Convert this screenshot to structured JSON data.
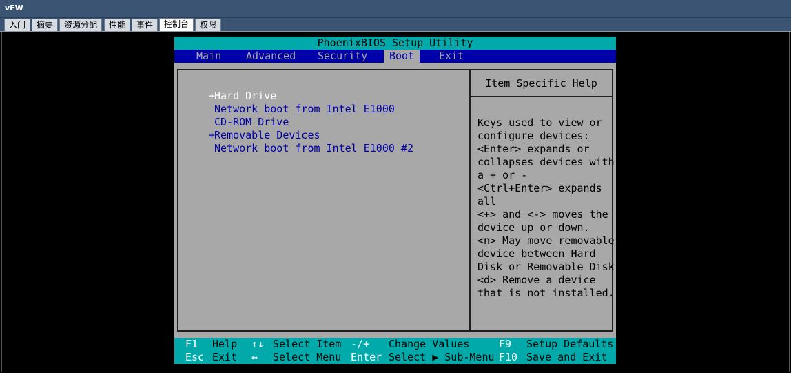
{
  "window": {
    "title": "vFW"
  },
  "tabs": [
    {
      "label": "入门"
    },
    {
      "label": "摘要"
    },
    {
      "label": "资源分配"
    },
    {
      "label": "性能"
    },
    {
      "label": "事件"
    },
    {
      "label": "控制台",
      "active": true
    },
    {
      "label": "权限"
    }
  ],
  "bios": {
    "title": "PhoenixBIOS Setup Utility",
    "menu": [
      "Main",
      "Advanced",
      "Security",
      "Boot",
      "Exit"
    ],
    "active_menu": "Boot",
    "boot_items": [
      {
        "marker": "+",
        "label": "Hard Drive",
        "selected": true
      },
      {
        "marker": "",
        "label": "Network boot from Intel E1000"
      },
      {
        "marker": "",
        "label": "CD-ROM Drive"
      },
      {
        "marker": "+",
        "label": "Removable Devices"
      },
      {
        "marker": "",
        "label": "Network boot from Intel E1000 #2"
      }
    ],
    "help_title": "Item Specific Help",
    "help_text": "Keys used to view or\nconfigure devices:\n<Enter> expands or\ncollapses devices with\na + or -\n<Ctrl+Enter> expands\nall\n<+> and <-> moves the\ndevice up or down.\n<n> May move removable\ndevice between Hard\nDisk or Removable Disk\n<d> Remove a device\nthat is not installed.",
    "footer": {
      "row1": [
        {
          "key": "F1",
          "desc": "Help"
        },
        {
          "key": "↑↓",
          "desc": "Select Item"
        },
        {
          "key": "-/+",
          "desc": "Change Values"
        },
        {
          "key": "F9",
          "desc": "Setup Defaults"
        }
      ],
      "row2": [
        {
          "key": "Esc",
          "desc": "Exit"
        },
        {
          "key": "↔",
          "desc": "Select Menu"
        },
        {
          "key": "Enter",
          "desc": "Select ▶ Sub-Menu"
        },
        {
          "key": "F10",
          "desc": "Save and Exit"
        }
      ]
    }
  },
  "colors": {
    "chrome": "#3c5473",
    "bios_gray": "#a8a8a8",
    "bios_blue": "#0000aa",
    "bios_cyan": "#00aaaa"
  }
}
